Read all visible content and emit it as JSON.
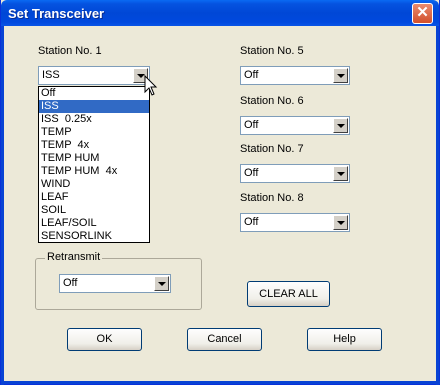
{
  "window": {
    "title": "Set Transceiver",
    "close_label": "✕"
  },
  "stations": {
    "s1": {
      "label": "Station No. 1",
      "value": "ISS"
    },
    "s5": {
      "label": "Station No. 5",
      "value": "Off"
    },
    "s6": {
      "label": "Station No. 6",
      "value": "Off"
    },
    "s7": {
      "label": "Station No. 7",
      "value": "Off"
    },
    "s8": {
      "label": "Station No. 8",
      "value": "Off"
    }
  },
  "dropdown": {
    "options": [
      "Off",
      "ISS",
      "ISS  0.25x",
      "TEMP",
      "TEMP  4x",
      "TEMP HUM",
      "TEMP HUM  4x",
      "WIND",
      "LEAF",
      "SOIL",
      "LEAF/SOIL",
      "SENSORLINK"
    ],
    "selected": "ISS"
  },
  "retransmit": {
    "label": "Retransmit",
    "value": "Off"
  },
  "buttons": {
    "clear_all": "CLEAR ALL",
    "ok": "OK",
    "cancel": "Cancel",
    "help": "Help"
  },
  "colors": {
    "titlebar": "#0047d6",
    "selection": "#316ac5"
  }
}
